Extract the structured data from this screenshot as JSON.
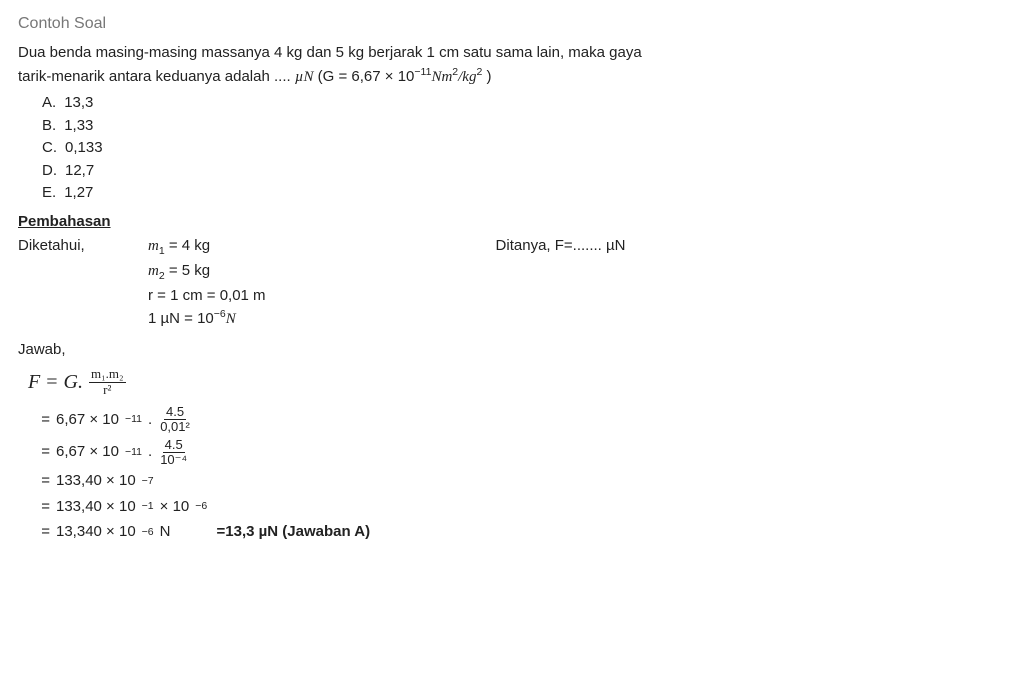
{
  "sectionTitle": "Contoh Soal",
  "problem": {
    "line1": "Dua benda masing-masing massanya 4 kg dan 5 kg berjarak 1 cm satu sama lain, maka gaya",
    "line2_prefix": "tarik-menarik antara keduanya adalah .... ",
    "unit": "µN",
    "g_label": " (G = ",
    "g_value": "6,67 × 10",
    "g_exp": "−11",
    "g_unit_n": "Nm",
    "g_unit_sq": "2",
    "g_unit_slash": "/kg",
    "g_unit_kg_sq": "2",
    "g_close": " )"
  },
  "options": {
    "A": {
      "letter": "A.",
      "text": "13,3"
    },
    "B": {
      "letter": "B.",
      "text": "1,33"
    },
    "C": {
      "letter": "C.",
      "text": "0,133"
    },
    "D": {
      "letter": "D.",
      "text": "12,7"
    },
    "E": {
      "letter": "E.",
      "text": "1,27"
    }
  },
  "pembahasan": "Pembahasan",
  "known": {
    "label": "Diketahui,",
    "m1": "m",
    "m1_sub": "1",
    "m1_val": " = 4 kg",
    "m2": "m",
    "m2_sub": "2",
    "m2_val": " = 5 kg",
    "r": "r   = 1 cm = 0,01 m",
    "mu_prefix": "1 µN = ",
    "mu_val": "10",
    "mu_exp": "−6",
    "mu_unit": "N"
  },
  "asked": {
    "label": "Ditanya, F=....... µN"
  },
  "jawab": "Jawab,",
  "formula": {
    "F": "F",
    "eq": " = ",
    "G": "G.",
    "num": "m₁.m₂",
    "den": "r²"
  },
  "steps": {
    "s1": {
      "eq": "=",
      "coef": "6,67 × 10",
      "exp": "−11",
      "dot": " . ",
      "fnum": "4.5",
      "fden": "0,01²"
    },
    "s2": {
      "eq": "=",
      "coef": "6,67 × 10",
      "exp": "−11",
      "dot": " . ",
      "fnum": "4.5",
      "fden": "10⁻⁴"
    },
    "s3": {
      "eq": "=",
      "text": "133,40 ×  10",
      "exp": "−7"
    },
    "s4": {
      "eq": "=",
      "text": "133,40 ×  10",
      "exp1": "−1",
      "mid": " × 10",
      "exp2": "−6"
    },
    "s5": {
      "eq": "=",
      "text": "13,340 × 10",
      "exp": "−6",
      "unit": " N",
      "answer": "=13,3 µN (Jawaban A)"
    }
  }
}
